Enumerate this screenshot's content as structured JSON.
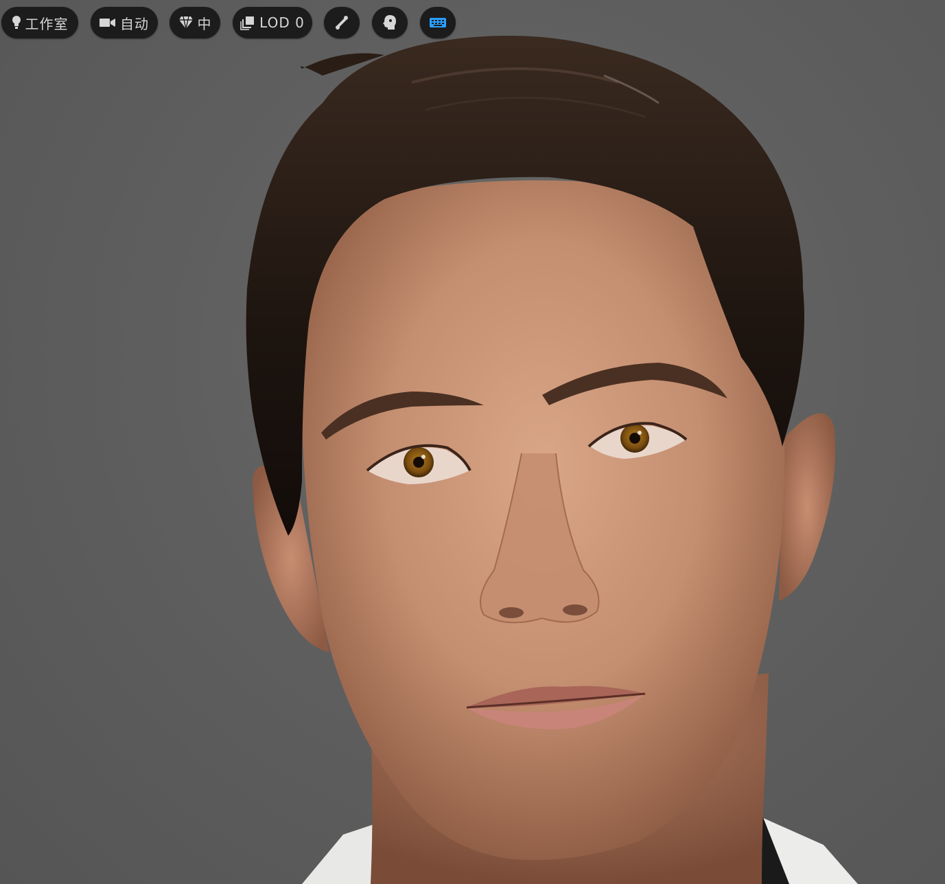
{
  "toolbar": {
    "lighting": {
      "label": "工作室",
      "icon": "lightbulb-icon"
    },
    "camera": {
      "label": "自动",
      "icon": "video-camera-icon"
    },
    "quality": {
      "label": "中",
      "icon": "diamond-icon"
    },
    "lod": {
      "label": "LOD 0",
      "icon": "layers-icon"
    },
    "skeleton": {
      "icon": "bone-icon"
    },
    "head": {
      "icon": "head-profile-icon"
    },
    "keyboard": {
      "icon": "keyboard-icon",
      "active_color": "#2a9fff"
    }
  },
  "colors": {
    "background": "#5e5e5e",
    "button_bg": "#1c1c1c",
    "button_text": "#d6d6d6",
    "skin": "#c99579",
    "hair": "#2a1c14",
    "eye_iris": "#7a4d10"
  }
}
